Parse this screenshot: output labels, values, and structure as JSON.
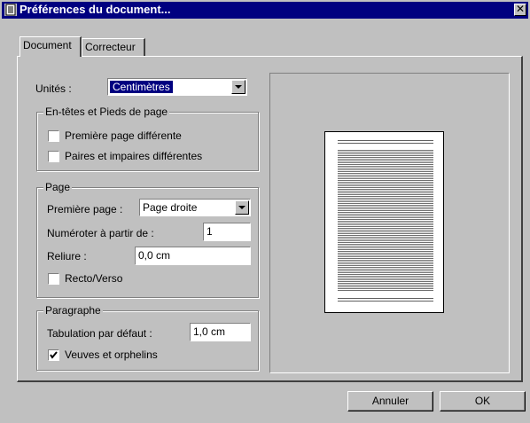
{
  "window": {
    "title": "Préférences du document...",
    "close_glyph": "✕"
  },
  "tabs": [
    {
      "label": "Document",
      "active": true
    },
    {
      "label": "Correcteur",
      "active": false
    }
  ],
  "units": {
    "label": "Unités :",
    "value": "Centimètres"
  },
  "headers_group": {
    "title": "En-têtes et Pieds de page",
    "options": [
      {
        "label": "Première page différente",
        "checked": false
      },
      {
        "label": "Paires et impaires différentes",
        "checked": false
      }
    ]
  },
  "page_group": {
    "title": "Page",
    "first_page_label": "Première page :",
    "first_page_value": "Page droite",
    "numbering_label": "Numéroter à partir de :",
    "numbering_value": "1",
    "binding_label": "Reliure :",
    "binding_value": "0,0 cm",
    "recto_verso_label": "Recto/Verso",
    "recto_verso_checked": false
  },
  "paragraph_group": {
    "title": "Paragraphe",
    "tab_label": "Tabulation par défaut :",
    "tab_value": "1,0 cm",
    "widows_label": "Veuves et orphelins",
    "widows_checked": true
  },
  "buttons": {
    "cancel": "Annuler",
    "ok": "OK"
  },
  "colors": {
    "title_bar": "#000080",
    "face": "#c0c0c0",
    "selection": "#000080"
  }
}
